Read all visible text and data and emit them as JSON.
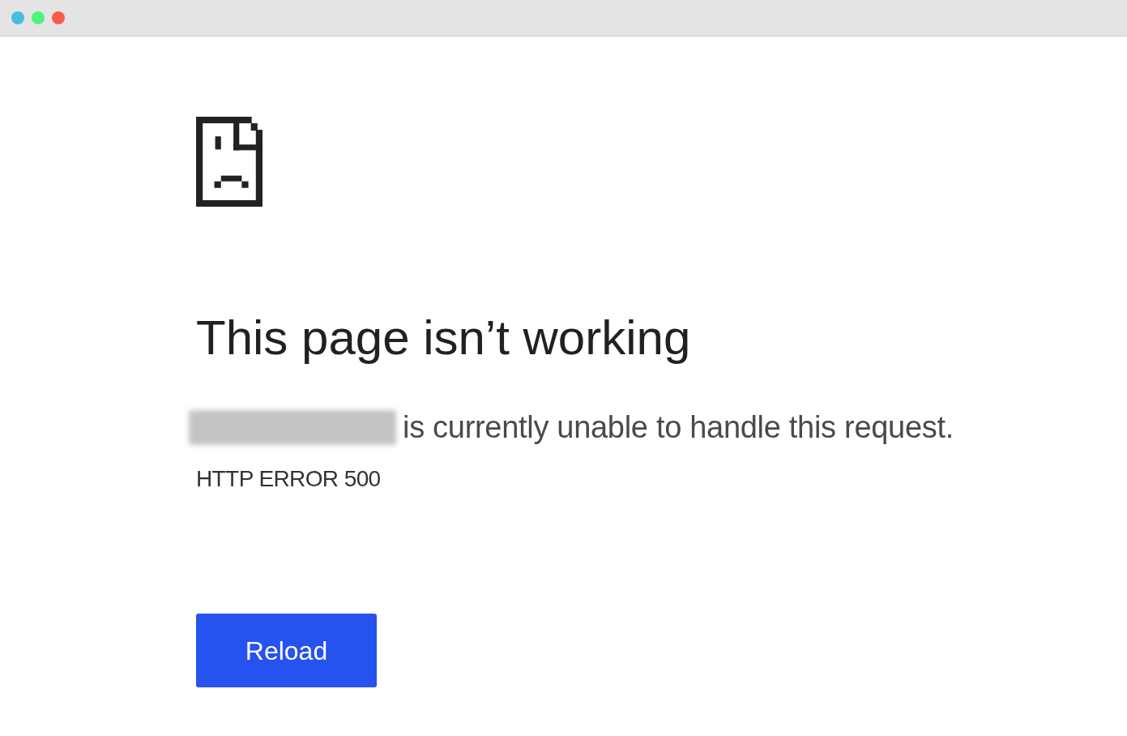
{
  "window": {
    "controls": [
      {
        "color": "#45bedf"
      },
      {
        "color": "#4cf57b"
      },
      {
        "color": "#fb5a48"
      }
    ]
  },
  "error": {
    "title": "This page isn’t working",
    "message": "is currently unable to handle this request.",
    "code": "HTTP ERROR 500",
    "button": "Reload"
  }
}
